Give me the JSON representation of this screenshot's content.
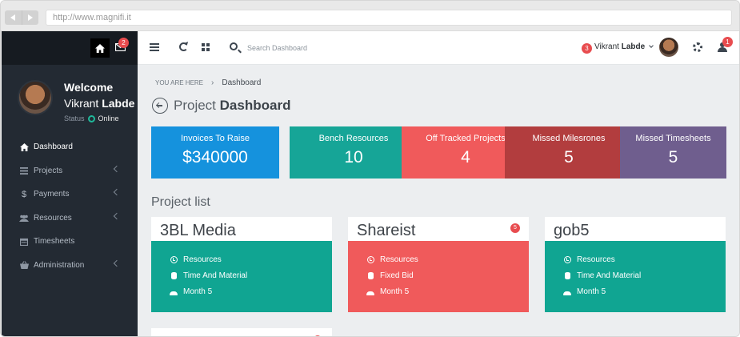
{
  "browser": {
    "url": "http://www.magnifi.it"
  },
  "sidebar": {
    "mail_badge": "2",
    "welcome": "Welcome",
    "first_name": "Vikrant",
    "last_name": "Labde",
    "status_label": "Status",
    "status_value": "Online",
    "items": [
      {
        "label": "Dashboard",
        "icon": "home-icon"
      },
      {
        "label": "Projects",
        "icon": "list-icon"
      },
      {
        "label": "Payments",
        "icon": "dollar-icon"
      },
      {
        "label": "Resources",
        "icon": "users-icon"
      },
      {
        "label": "Timesheets",
        "icon": "calendar-icon"
      },
      {
        "label": "Administration",
        "icon": "basket-icon"
      }
    ]
  },
  "header": {
    "search_placeholder": "Search Dashboard",
    "user_badge": "3",
    "user_first": "Vikrant",
    "user_last": "Labde",
    "people_badge": "1"
  },
  "breadcrumb": {
    "prefix": "YOU ARE HERE",
    "separator": "›",
    "current": "Dashboard"
  },
  "page": {
    "title_light": "Project",
    "title_bold": "Dashboard"
  },
  "stats": [
    {
      "label": "Invoices To Raise",
      "value": "$340000",
      "color": "#1592dd"
    },
    {
      "label": "Bench Resources",
      "value": "10",
      "color": "#16a597"
    },
    {
      "label": "Off Tracked Projects",
      "value": "4",
      "color": "#f05a5b"
    },
    {
      "label": "Missed Milesrones",
      "value": "5",
      "color": "#b23d3e"
    },
    {
      "label": "Missed Timesheets",
      "value": "5",
      "color": "#6f5e8e"
    }
  ],
  "project_list": {
    "title": "Project list",
    "projects": [
      {
        "name": "3BL Media",
        "color": "#10a592",
        "badge": "",
        "rows": [
          "Resources",
          "Time And Material",
          "Month 5"
        ]
      },
      {
        "name": "Shareist",
        "color": "#f05a5b",
        "badge": "5",
        "rows": [
          "Resources",
          "Fixed Bid",
          "Month 5"
        ]
      },
      {
        "name": "gob5",
        "color": "#10a592",
        "badge": "",
        "rows": [
          "Resources",
          "Time And Material",
          "Month 5"
        ]
      }
    ]
  },
  "colors": {
    "sidebar_bg": "#232a33",
    "badge": "#e84c4f",
    "status_online": "#1fb89a"
  }
}
